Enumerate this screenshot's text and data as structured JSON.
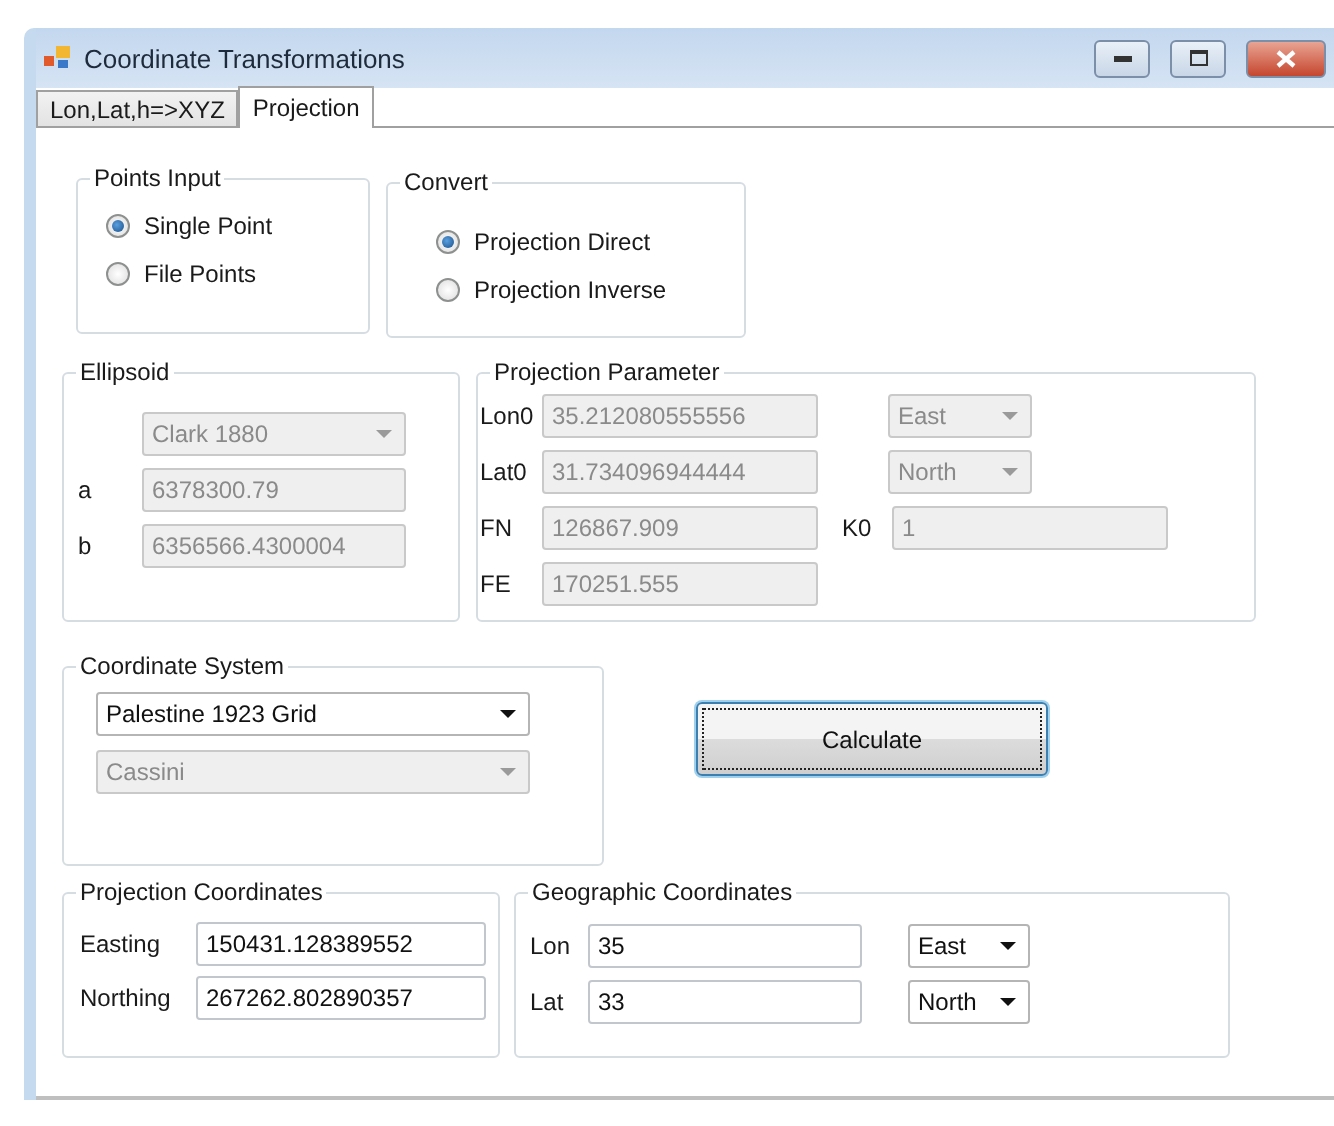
{
  "window": {
    "title": "Coordinate Transformations"
  },
  "tabs": [
    {
      "label": "Lon,Lat,h=>XYZ",
      "selected": false
    },
    {
      "label": "Projection",
      "selected": true
    }
  ],
  "points_input": {
    "title": "Points Input",
    "options": [
      {
        "label": "Single Point",
        "selected": true
      },
      {
        "label": "File Points",
        "selected": false
      }
    ]
  },
  "convert": {
    "title": "Convert",
    "options": [
      {
        "label": "Projection Direct",
        "selected": true
      },
      {
        "label": "Projection Inverse",
        "selected": false
      }
    ]
  },
  "ellipsoid": {
    "title": "Ellipsoid",
    "model": {
      "value": "Clark 1880",
      "disabled": true
    },
    "fields": [
      {
        "label": "a",
        "value": "6378300.79",
        "disabled": true
      },
      {
        "label": "b",
        "value": "6356566.4300004",
        "disabled": true
      }
    ]
  },
  "projection_parameter": {
    "title": "Projection Parameter",
    "rows": [
      {
        "label": "Lon0",
        "value": "35.212080555556",
        "disabled": true,
        "side": {
          "kind": "combo",
          "value": "East",
          "disabled": true
        }
      },
      {
        "label": "Lat0",
        "value": "31.734096944444",
        "disabled": true,
        "side": {
          "kind": "combo",
          "value": "North",
          "disabled": true
        }
      },
      {
        "label": "FN",
        "value": "126867.909",
        "disabled": true,
        "side": {
          "kind": "field",
          "label": "K0",
          "value": "1",
          "disabled": true
        }
      },
      {
        "label": "FE",
        "value": "170251.555",
        "disabled": true
      }
    ]
  },
  "coordinate_system": {
    "title": "Coordinate System",
    "combos": [
      {
        "value": "Palestine 1923 Grid",
        "disabled": false
      },
      {
        "value": "Cassini",
        "disabled": true
      }
    ]
  },
  "calculate_button": {
    "label": "Calculate",
    "focused": true
  },
  "projection_coordinates": {
    "title": "Projection Coordinates",
    "fields": [
      {
        "label": "Easting",
        "value": "150431.128389552",
        "disabled": false
      },
      {
        "label": "Northing",
        "value": "267262.802890357",
        "disabled": false
      }
    ]
  },
  "geographic_coordinates": {
    "title": "Geographic Coordinates",
    "rows": [
      {
        "label": "Lon",
        "value": "35",
        "disabled": false,
        "side": {
          "kind": "combo",
          "value": "East",
          "disabled": false
        }
      },
      {
        "label": "Lat",
        "value": "33",
        "disabled": false,
        "side": {
          "kind": "combo",
          "value": "North",
          "disabled": false
        }
      }
    ]
  }
}
